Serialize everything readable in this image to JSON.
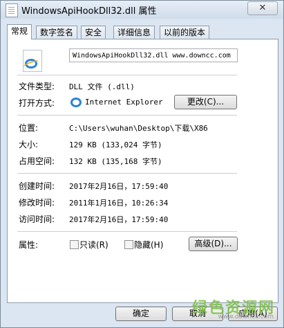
{
  "window": {
    "title": "WindowsApiHookDll32.dll 属性",
    "close_label": "✕"
  },
  "tabs": [
    {
      "label": "常规",
      "active": true
    },
    {
      "label": "数字签名",
      "active": false
    },
    {
      "label": "安全",
      "active": false
    },
    {
      "label": "详细信息",
      "active": false
    },
    {
      "label": "以前的版本",
      "active": false
    }
  ],
  "general": {
    "file_name": "WindowsApiHookDll32.dll  www.downcc.com",
    "file_type_label": "文件类型:",
    "file_type_value": "DLL 文件 (.dll)",
    "open_with_label": "打开方式:",
    "open_with_value": "Internet Explorer",
    "change_button": "更改(C)...",
    "location_label": "位置:",
    "location_value": "C:\\Users\\wuhan\\Desktop\\下载\\X86",
    "size_label": "大小:",
    "size_value": "129 KB (133,024 字节)",
    "disk_size_label": "占用空间:",
    "disk_size_value": "132 KB (135,168 字节)",
    "created_label": "创建时间:",
    "created_value": "2017年2月16日，17:59:40",
    "modified_label": "修改时间:",
    "modified_value": "2011年1月16日，10:26:34",
    "accessed_label": "访问时间:",
    "accessed_value": "2017年2月16日，17:59:40",
    "attributes_label": "属性:",
    "readonly_label": "只读(R)",
    "hidden_label": "隐藏(H)",
    "advanced_button": "高级(D)..."
  },
  "footer": {
    "ok_button": "确定",
    "cancel_button": "取消",
    "apply_button": "应用(A)"
  },
  "watermark": {
    "text": "绿色资源网",
    "url": "www.downcc.com"
  },
  "icons": {
    "file_icon": "ie-file-icon",
    "open_with_icon": "ie-icon"
  },
  "colors": {
    "window_frame": "#dbe6f2",
    "panel": "#ffffff",
    "watermark": "#7bc043"
  }
}
